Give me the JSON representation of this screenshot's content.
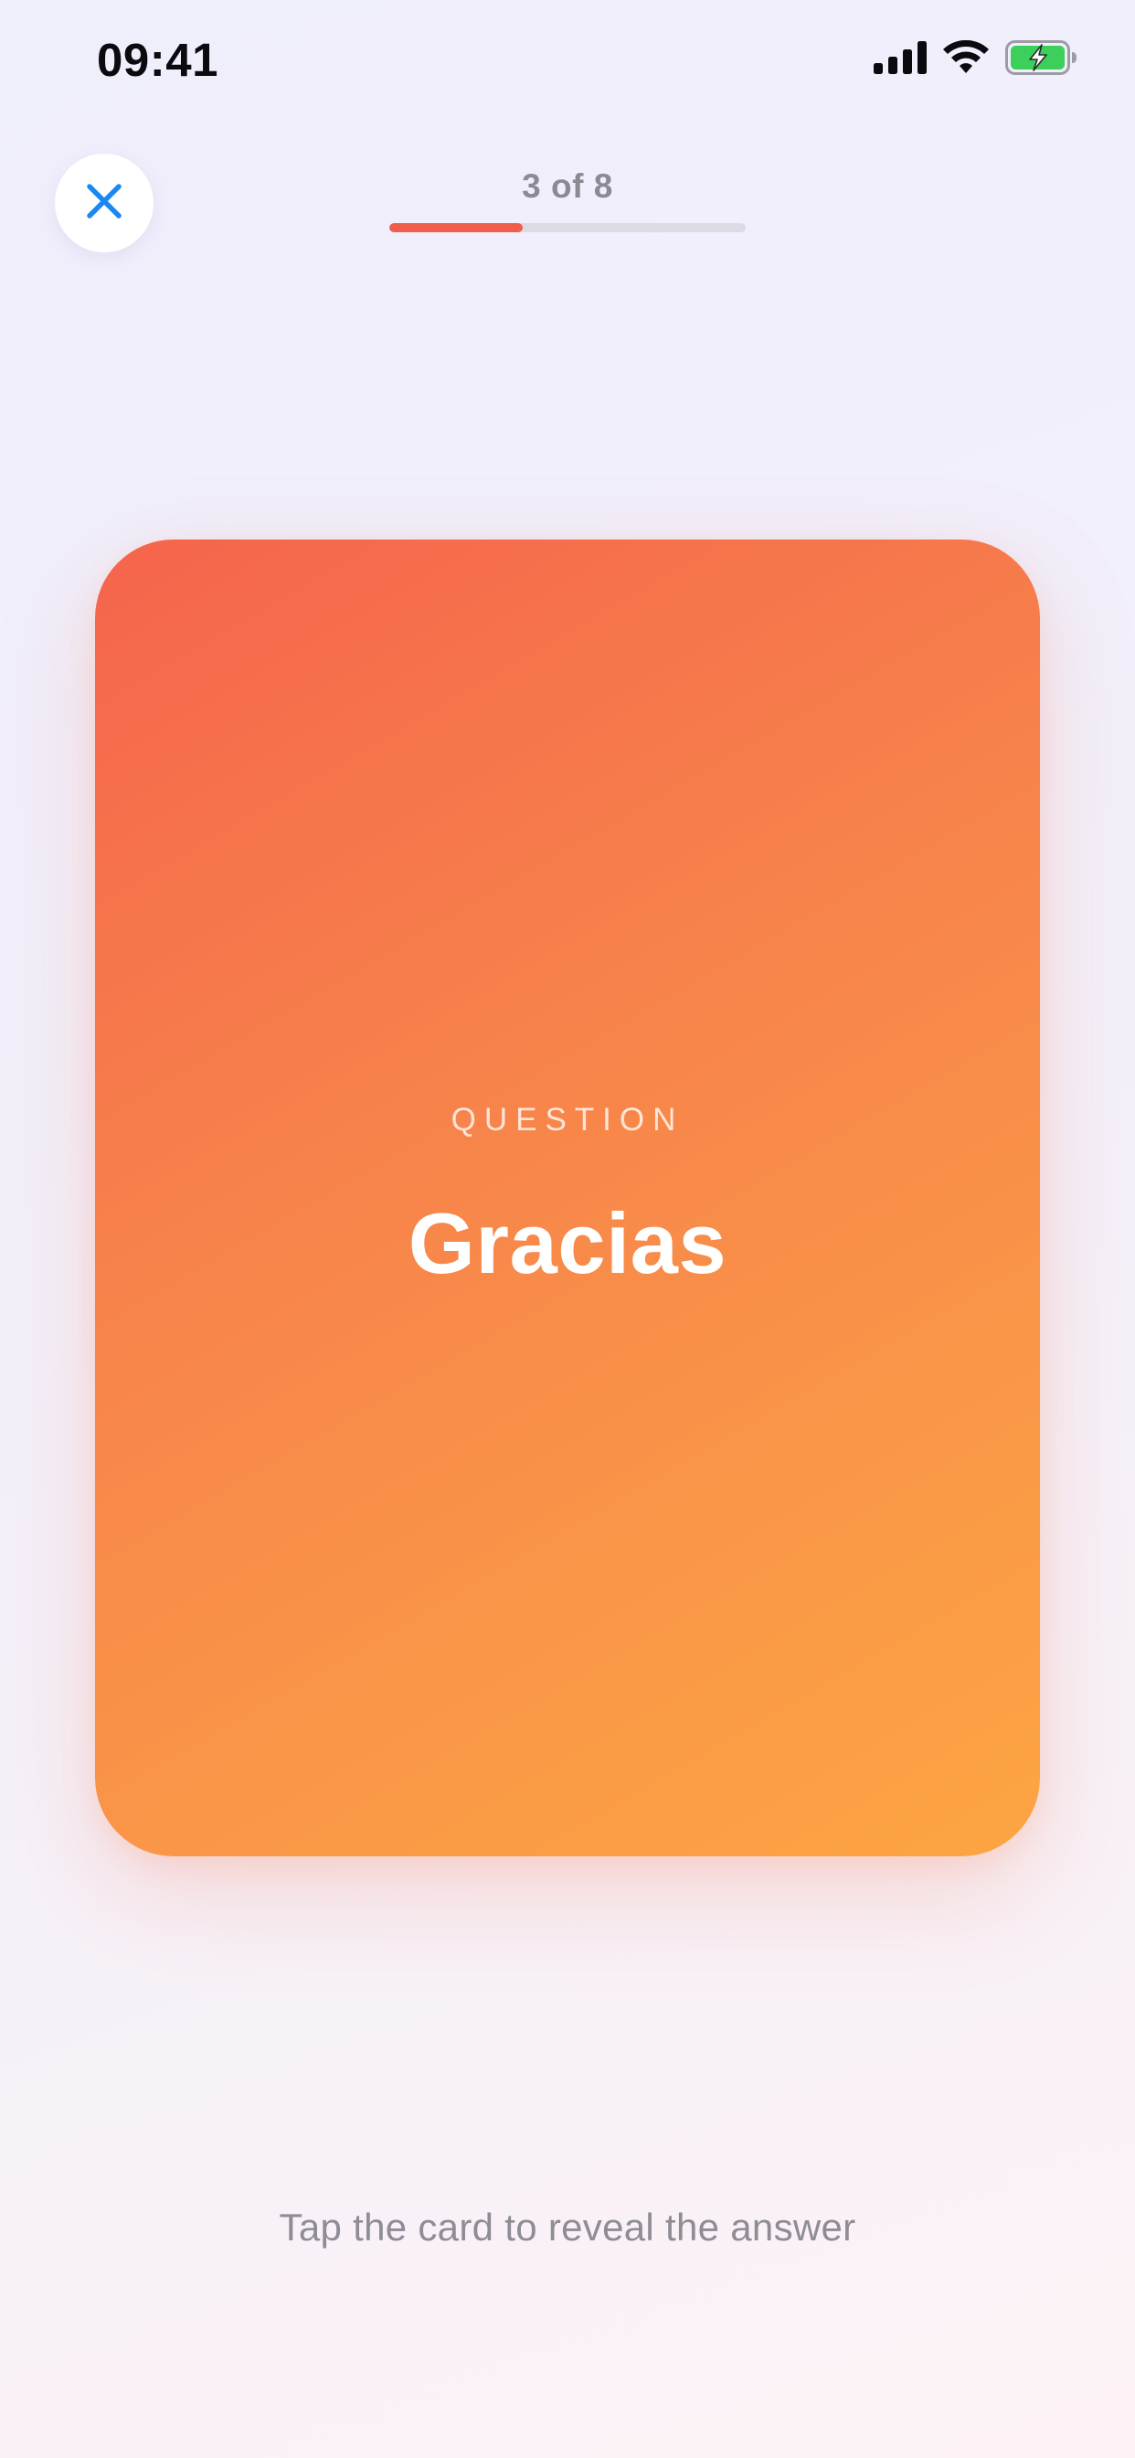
{
  "status_bar": {
    "time": "09:41",
    "icons": [
      "cellular-signal-icon",
      "wifi-icon",
      "battery-charging-icon"
    ]
  },
  "header": {
    "close_icon": "close-icon",
    "progress_label": "3 of 8",
    "progress_fraction": 0.375
  },
  "card": {
    "kicker": "QUESTION",
    "word": "Gracias"
  },
  "hint": "Tap the card to reveal the answer",
  "colors": {
    "accent": "#ef5d4d",
    "close_icon": "#1a88f0",
    "card_gradient_start": "#f5644c",
    "card_gradient_end": "#fca542",
    "battery_fill": "#3ccf5a"
  }
}
